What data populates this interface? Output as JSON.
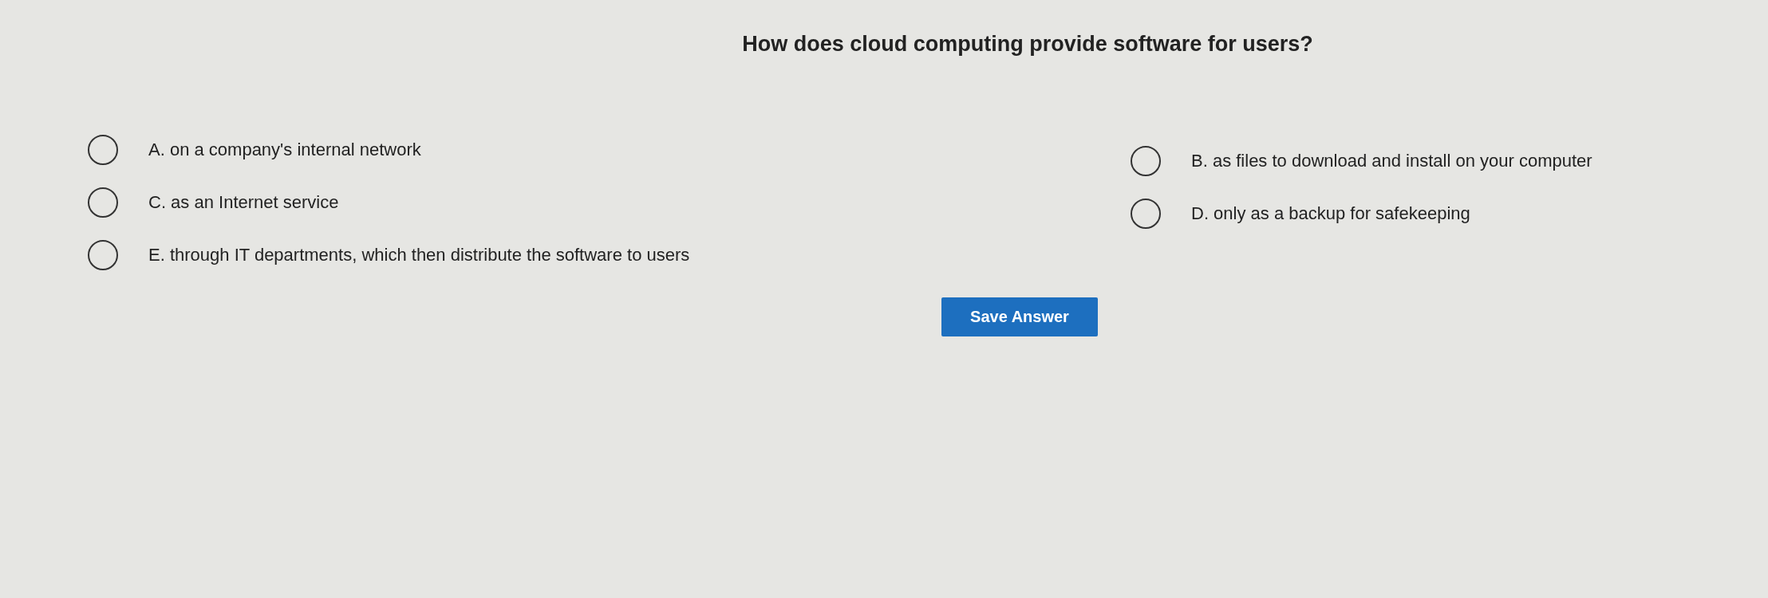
{
  "question": "How does cloud computing provide software for users?",
  "left_options": [
    {
      "label": "A. on a company's internal network",
      "selected": false
    },
    {
      "label": "C. as an Internet service",
      "selected": false
    },
    {
      "label": "E. through IT departments, which then distribute the software to users",
      "selected": false
    }
  ],
  "right_options": [
    {
      "label": "B. as files to download and install on your computer",
      "selected": false
    },
    {
      "label": "D. only as a backup for safekeeping",
      "selected": false
    }
  ],
  "button": "Save Answer"
}
